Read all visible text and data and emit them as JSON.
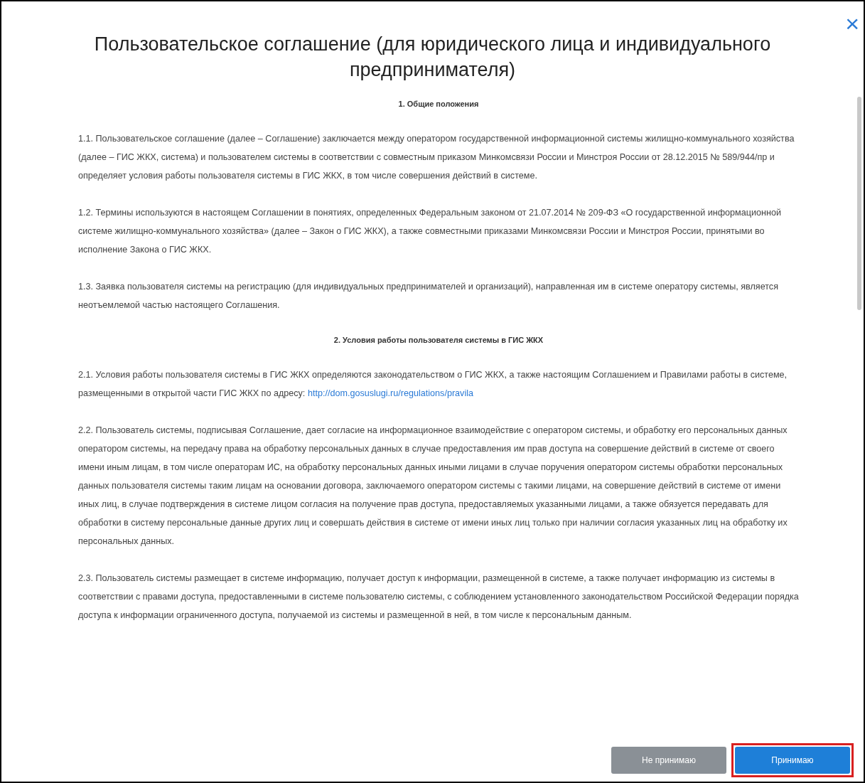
{
  "dialog": {
    "title": "Пользовательское соглашение (для юридического лица и индивидуального предпринимателя)",
    "close_label": "×"
  },
  "content": [
    {
      "kind": "heading",
      "text": "1. Общие положения"
    },
    {
      "kind": "paragraph",
      "text": "1.1. Пользовательское соглашение (далее – Соглашение) заключается между оператором государственной информационной системы жилищно-коммунального хозяйства (далее – ГИС ЖКХ, система) и пользователем системы в соответствии с совместным приказом Минкомсвязи России и Минстроя России от 28.12.2015 № 589/944/пр и определяет условия работы пользователя системы в ГИС ЖКХ, в том числе совершения действий в системе."
    },
    {
      "kind": "paragraph",
      "text": "1.2. Термины используются в настоящем Соглашении в понятиях, определенных Федеральным законом от 21.07.2014 № 209-ФЗ «О государственной информационной системе жилищно-коммунального хозяйства» (далее – Закон о ГИС ЖКХ), а также совместными приказами Минкомсвязи России и Минстроя России, принятыми во исполнение Закона о ГИС ЖКХ."
    },
    {
      "kind": "paragraph",
      "text": "1.3. Заявка пользователя системы на регистрацию (для индивидуальных предпринимателей и организаций), направленная им в системе оператору системы, является неотъемлемой частью настоящего Соглашения."
    },
    {
      "kind": "heading",
      "text": "2. Условия работы пользователя системы в ГИС ЖКХ"
    },
    {
      "kind": "paragraph",
      "text": "2.1. Условия работы пользователя системы в ГИС ЖКХ определяются законодательством о ГИС ЖКХ, а также настоящим Соглашением и Правилами работы в системе, размещенными в открытой части ГИС ЖКХ по адресу:",
      "link": "http://dom.gosuslugi.ru/regulations/pravila"
    },
    {
      "kind": "paragraph",
      "text": "2.2. Пользователь системы, подписывая Соглашение, дает согласие на информационное взаимодействие с оператором системы, и обработку его персональных данных оператором системы, на передачу права на обработку персональных данных в случае предоставления им прав доступа на совершение действий в системе от своего имени иным лицам, в том числе операторам ИС, на обработку персональных данных иными лицами в случае поручения оператором системы обработки персональных данных пользователя системы таким лицам на основании договора, заключаемого оператором системы с такими лицами, на совершение действий в системе от имени иных лиц, в случае подтверждения в системе лицом согласия на получение прав доступа, предоставляемых указанными лицами, а также обязуется передавать для обработки в систему персональные данные других лиц и совершать действия в системе от имени иных лиц только при наличии согласия указанных лиц на обработку их персональных данных."
    },
    {
      "kind": "paragraph",
      "text": "2.3. Пользователь системы размещает в системе информацию, получает доступ к информации, размещенной в системе, а также получает информацию из системы в соответствии с правами доступа, предоставленными в системе пользователю системы, с соблюдением установленного законодательством Российской Федерации порядка доступа к информации ограниченного доступа, получаемой из системы и размещенной в ней, в том числе к персональным данным."
    }
  ],
  "buttons": [
    {
      "kind": "secondary",
      "label": "Не принимаю",
      "highlighted": false
    },
    {
      "kind": "primary",
      "label": "Принимаю",
      "highlighted": true
    }
  ]
}
